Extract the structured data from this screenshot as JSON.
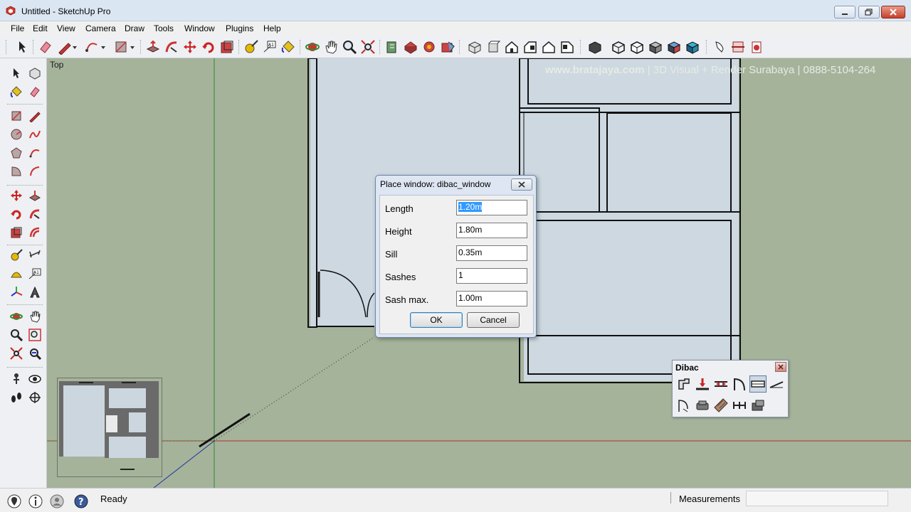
{
  "window": {
    "title": "Untitled - SketchUp Pro"
  },
  "menu": [
    "File",
    "Edit",
    "View",
    "Camera",
    "Draw",
    "Tools",
    "Window",
    "Plugins",
    "Help"
  ],
  "viewport": {
    "view_label": "Top",
    "watermark_brand": "www.bratajaya.com",
    "watermark_rest": " | 3D Visual + Render Surabaya | 0888-5104-264"
  },
  "dialog": {
    "title": "Place window: dibac_window",
    "fields": [
      {
        "label": "Length",
        "value": "1.20m"
      },
      {
        "label": "Height",
        "value": "1.80m"
      },
      {
        "label": "Sill",
        "value": "0.35m"
      },
      {
        "label": "Sashes",
        "value": "1"
      },
      {
        "label": "Sash max.",
        "value": "1.00m"
      }
    ],
    "ok_label": "OK",
    "cancel_label": "Cancel"
  },
  "dibac": {
    "title": "Dibac"
  },
  "status": {
    "text": "Ready",
    "measurements_label": "Measurements",
    "measurements_value": ""
  },
  "colors": {
    "viewport_bg": "#a5b39b",
    "floor_fill": "#cdd8e1",
    "wall_line": "#111111",
    "axis_green": "#2a8a2a",
    "axis_red": "#b03030",
    "selection": "#3399ff"
  }
}
